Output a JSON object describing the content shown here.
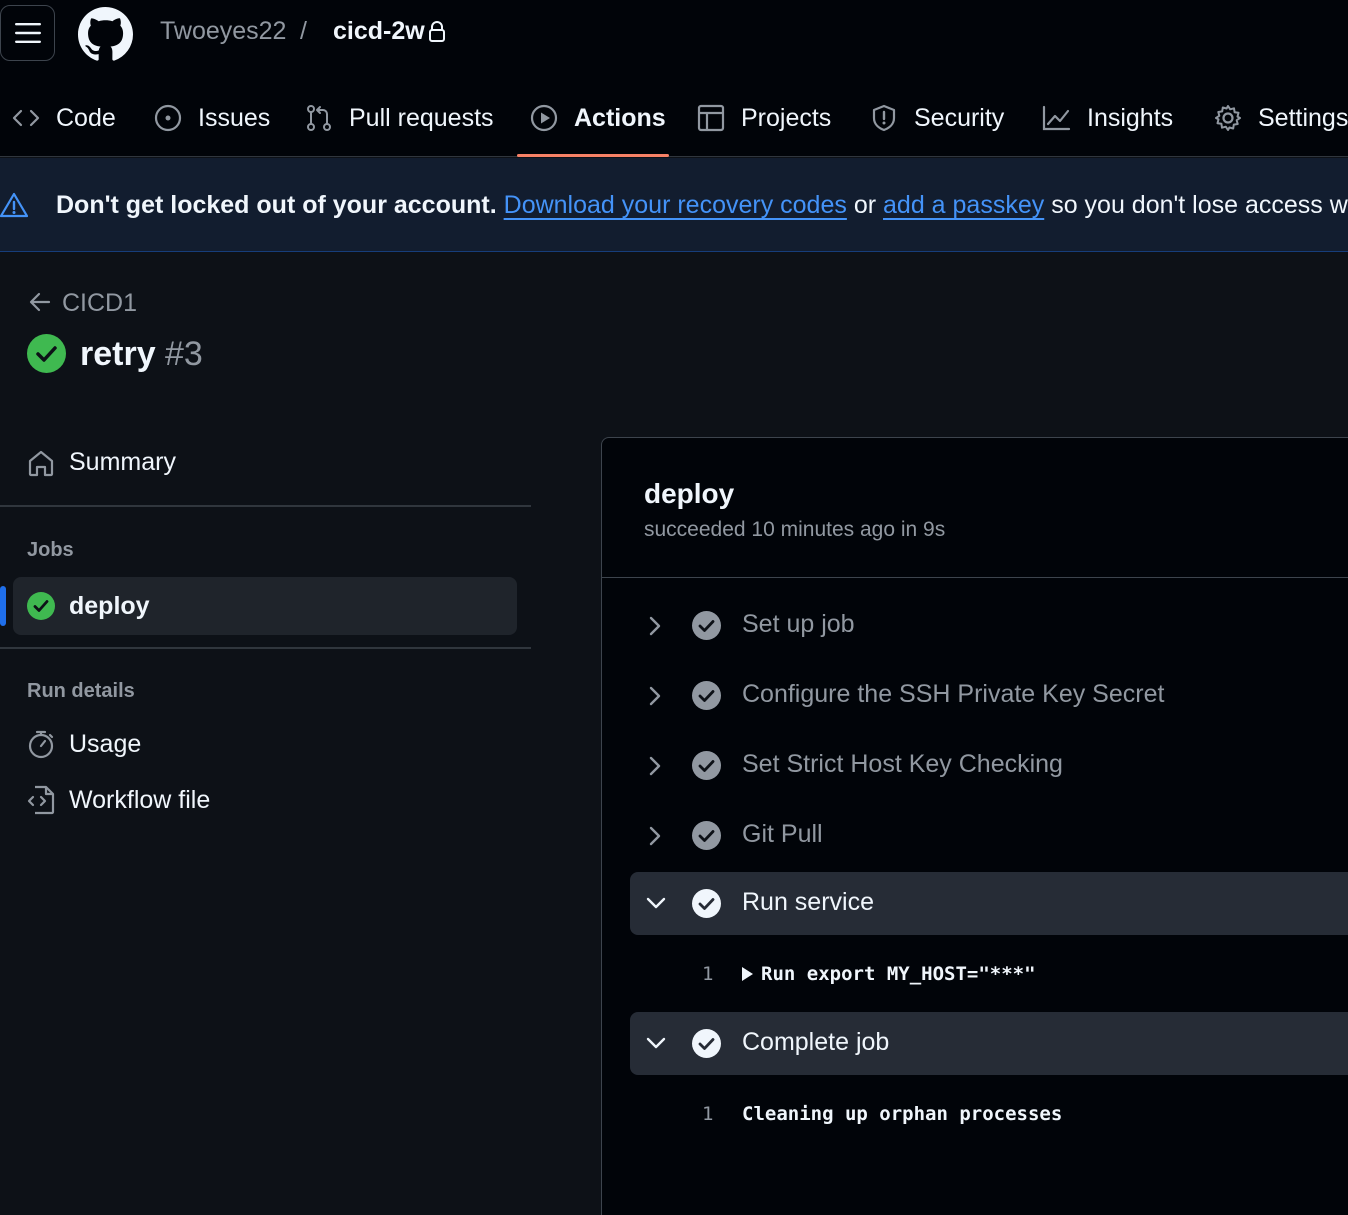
{
  "header": {
    "owner": "Twoeyes22",
    "separator": "/",
    "repo": "cicd-2w",
    "tabs": [
      {
        "label": "Code",
        "icon": "code-icon"
      },
      {
        "label": "Issues",
        "icon": "issue-opened-icon"
      },
      {
        "label": "Pull requests",
        "icon": "git-pull-request-icon"
      },
      {
        "label": "Actions",
        "icon": "play-icon",
        "active": true
      },
      {
        "label": "Projects",
        "icon": "table-icon"
      },
      {
        "label": "Security",
        "icon": "shield-icon"
      },
      {
        "label": "Insights",
        "icon": "graph-icon"
      },
      {
        "label": "Settings",
        "icon": "gear-icon"
      }
    ]
  },
  "banner": {
    "bold_text": "Don't get locked out of your account.",
    "link1": "Download your recovery codes",
    "mid": "or",
    "link2": "add a passkey",
    "tail": "so you don't lose access when y"
  },
  "run": {
    "back_label": "CICD1",
    "title": "retry",
    "number": "#3",
    "status_color": "#3fb950"
  },
  "sidebar": {
    "summary": "Summary",
    "jobs_header": "Jobs",
    "jobs": [
      {
        "label": "deploy"
      }
    ],
    "run_details_header": "Run details",
    "links": [
      {
        "label": "Usage",
        "icon": "stopwatch-icon"
      },
      {
        "label": "Workflow file",
        "icon": "file-code-icon"
      }
    ]
  },
  "job": {
    "title": "deploy",
    "subtitle": "succeeded 10 minutes ago in 9s",
    "steps": [
      {
        "label": "Set up job",
        "expanded": false
      },
      {
        "label": "Configure the SSH Private Key Secret",
        "expanded": false
      },
      {
        "label": "Set Strict Host Key Checking",
        "expanded": false
      },
      {
        "label": "Git Pull",
        "expanded": false
      },
      {
        "label": "Run service",
        "expanded": true,
        "log": [
          {
            "line": "1",
            "text": "Run export MY_HOST=\"***\""
          }
        ]
      },
      {
        "label": "Complete job",
        "expanded": true,
        "log": [
          {
            "line": "1",
            "text": "Cleaning up orphan processes"
          }
        ]
      }
    ]
  }
}
